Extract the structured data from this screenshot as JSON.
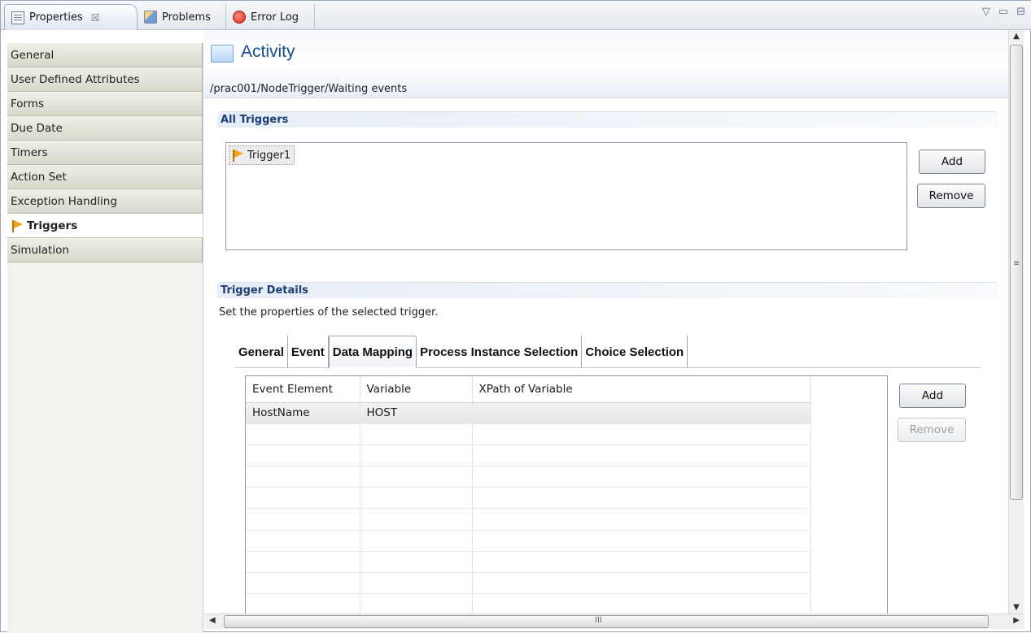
{
  "tabs": [
    {
      "label": "Properties",
      "icon": "properties-icon",
      "close": "☒"
    },
    {
      "label": "Problems",
      "icon": "problems-icon"
    },
    {
      "label": "Error Log",
      "icon": "error-log-icon"
    }
  ],
  "view_controls": {
    "menu": "▽",
    "minimize": "▭",
    "maximize": "⊟"
  },
  "categories": [
    {
      "label": "General"
    },
    {
      "label": "User Defined Attributes"
    },
    {
      "label": "Forms"
    },
    {
      "label": "Due Date"
    },
    {
      "label": "Timers"
    },
    {
      "label": "Action Set"
    },
    {
      "label": "Exception Handling"
    },
    {
      "label": "Triggers",
      "selected": true,
      "icon": "trigger-flag-icon"
    },
    {
      "label": "Simulation"
    }
  ],
  "header": {
    "title": "Activity",
    "path": "/prac001/NodeTrigger/Waiting events"
  },
  "all_triggers": {
    "heading": "All Triggers",
    "items": [
      "Trigger1"
    ],
    "add_label": "Add",
    "remove_label": "Remove"
  },
  "trigger_details": {
    "heading": "Trigger Details",
    "description": "Set the properties of the selected trigger.",
    "tabs": [
      "General",
      "Event",
      "Data Mapping",
      "Process Instance Selection",
      "Choice Selection"
    ],
    "active_tab": "Data Mapping",
    "columns": [
      "Event Element",
      "Variable",
      "XPath of Variable",
      ""
    ],
    "rows": [
      [
        "HostName",
        "HOST",
        "",
        ""
      ]
    ],
    "add_label": "Add",
    "remove_label": "Remove"
  },
  "scrollbars": {
    "up": "▲",
    "down": "▼",
    "left": "◀",
    "right": "▶",
    "vgrip": "≡",
    "hgrip": "III"
  }
}
